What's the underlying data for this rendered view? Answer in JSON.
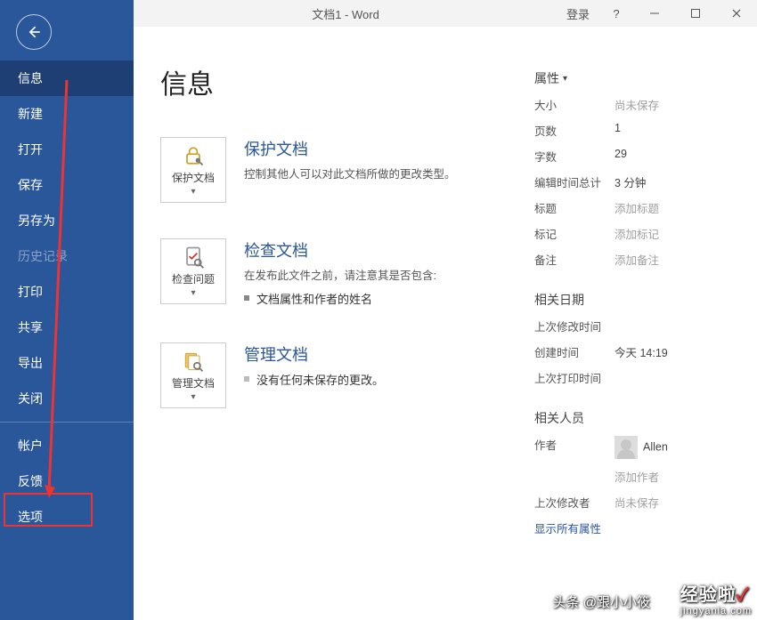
{
  "titlebar": {
    "title": "文档1  -  Word",
    "login": "登录",
    "help": "?"
  },
  "sidebar": {
    "items": [
      {
        "label": "信息",
        "active": true
      },
      {
        "label": "新建"
      },
      {
        "label": "打开"
      },
      {
        "label": "保存"
      },
      {
        "label": "另存为"
      },
      {
        "label": "历史记录",
        "disabled": true
      },
      {
        "label": "打印"
      },
      {
        "label": "共享"
      },
      {
        "label": "导出"
      },
      {
        "label": "关闭"
      }
    ],
    "bottom": [
      {
        "label": "帐户"
      },
      {
        "label": "反馈"
      },
      {
        "label": "选项"
      }
    ]
  },
  "page": {
    "heading": "信息",
    "protect": {
      "tile": "保护文档",
      "title": "保护文档",
      "body": "控制其他人可以对此文档所做的更改类型。"
    },
    "inspect": {
      "tile": "检查问题",
      "title": "检查文档",
      "lead": "在发布此文件之前，请注意其是否包含:",
      "bullet": "文档属性和作者的姓名"
    },
    "manage": {
      "tile": "管理文档",
      "title": "管理文档",
      "bullet": "没有任何未保存的更改。"
    }
  },
  "props": {
    "head": "属性",
    "rows": [
      {
        "k": "大小",
        "v": "尚未保存",
        "muted": true
      },
      {
        "k": "页数",
        "v": "1"
      },
      {
        "k": "字数",
        "v": "29"
      },
      {
        "k": "编辑时间总计",
        "v": "3 分钟"
      },
      {
        "k": "标题",
        "v": "添加标题",
        "muted": true
      },
      {
        "k": "标记",
        "v": "添加标记",
        "muted": true
      },
      {
        "k": "备注",
        "v": "添加备注",
        "muted": true
      }
    ],
    "dates_head": "相关日期",
    "dates": [
      {
        "k": "上次修改时间",
        "v": ""
      },
      {
        "k": "创建时间",
        "v": "今天 14:19"
      },
      {
        "k": "上次打印时间",
        "v": ""
      }
    ],
    "people_head": "相关人员",
    "author_k": "作者",
    "author_v": "Allen",
    "add_author": "添加作者",
    "last_mod_k": "上次修改者",
    "last_mod_v": "尚未保存",
    "show_all": "显示所有属性"
  },
  "watermark": {
    "line1": "头条 @跟小小筱",
    "brand": "经验啦",
    "domain": "jingyanla.com"
  }
}
